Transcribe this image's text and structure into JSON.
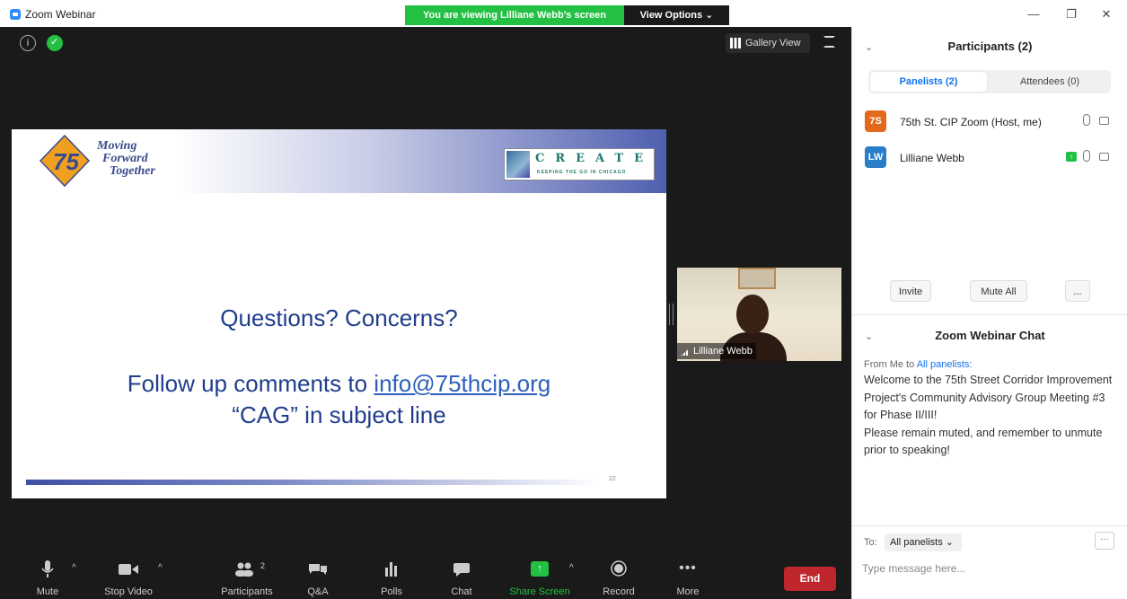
{
  "window": {
    "title": "Zoom Webinar",
    "viewing_banner": "You are viewing Lilliane Webb's screen",
    "view_options": "View Options ⌄",
    "controls": {
      "minimize": "—",
      "restore": "❐",
      "close": "✕"
    }
  },
  "stage": {
    "info_icon": "i",
    "gallery_view": "Gallery View"
  },
  "slide": {
    "tagline": [
      "Moving",
      "Forward",
      "Together"
    ],
    "logo_right_word": "CREATE",
    "logo_right_sub": "KEEPING THE GO IN CHICAGO",
    "question": "Questions? Concerns?",
    "follow_prefix": "Follow up comments to ",
    "follow_email": "info@75thcip.org",
    "cag_line": "“CAG” in subject line",
    "page_number": "22"
  },
  "video": {
    "name": "Lilliane Webb"
  },
  "toolbar": {
    "mute": "Mute",
    "stop_video": "Stop Video",
    "participants": "Participants",
    "participants_count": "2",
    "qa": "Q&A",
    "polls": "Polls",
    "chat": "Chat",
    "share_screen": "Share Screen",
    "record": "Record",
    "more": "More",
    "end": "End",
    "caret": "^"
  },
  "participants": {
    "title": "Participants (2)",
    "tabs": {
      "panelists": "Panelists (2)",
      "attendees": "Attendees (0)"
    },
    "list": [
      {
        "initials": "7S",
        "name": "75th St. CIP Zoom (Host, me)",
        "color": "#e36a1c"
      },
      {
        "initials": "LW",
        "name": "Lilliane Webb",
        "color": "#2a7ec7"
      }
    ],
    "invite": "Invite",
    "mute_all": "Mute All",
    "more": "..."
  },
  "chat": {
    "title": "Zoom Webinar Chat",
    "from_prefix": "From Me to ",
    "from_target": "All panelists",
    "from_suffix": ":",
    "message_1": "Welcome to the 75th Street Corridor Improvement Project's Community Advisory Group Meeting #3 for Phase II/III!",
    "message_2": "Please remain muted, and remember to unmute prior to speaking!",
    "to_label": "To:",
    "to_value": "All panelists ⌄",
    "more": "···",
    "input_placeholder": "Type message here..."
  },
  "colors": {
    "share_green": "#23c043",
    "zoom_blue": "#0e72ed",
    "end_red": "#c0272d"
  }
}
